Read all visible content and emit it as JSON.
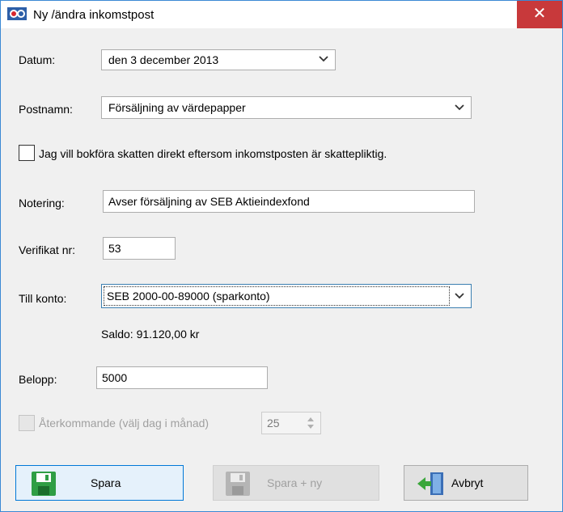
{
  "window": {
    "title": "Ny /ändra inkomstpost",
    "close_glyph": "✕"
  },
  "form": {
    "datum_label": "Datum:",
    "datum_value": "den 3 december 2013",
    "postnamn_label": "Postnamn:",
    "postnamn_value": "Försäljning av värdepapper",
    "tax_checkbox_label": "Jag vill bokföra skatten direkt eftersom inkomstposten är skattepliktig.",
    "tax_checkbox_checked": false,
    "notering_label": "Notering:",
    "notering_value": "Avser försäljning av SEB Aktieindexfond",
    "verifikat_label": "Verifikat nr:",
    "verifikat_value": "53",
    "till_konto_label": "Till konto:",
    "till_konto_value": "SEB 2000-00-89000 (sparkonto)",
    "saldo_text": "Saldo: 91.120,00 kr",
    "belopp_label": "Belopp:",
    "belopp_value": "5000",
    "recurring_label": "Återkommande (välj dag i månad)",
    "recurring_day": "25",
    "recurring_enabled": false
  },
  "buttons": {
    "save_label": "Spara",
    "save_new_label": "Spara + ny",
    "cancel_label": "Avbryt"
  },
  "colors": {
    "close_bg": "#c8393b",
    "window_border": "#3b89d4",
    "focus_border": "#3c7fb1",
    "disabled_text": "#a0a0a0"
  }
}
